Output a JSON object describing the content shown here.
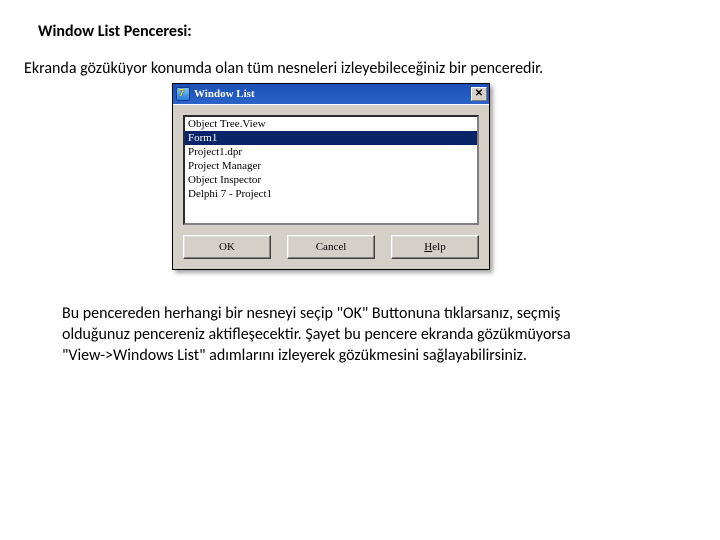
{
  "heading": "Window List Penceresi:",
  "intro": "Ekranda gözüküyor konumda olan tüm nesneleri izleyebileceğiniz bir penceredir.",
  "dialog": {
    "title": "Window List",
    "close_glyph": "✕",
    "list": {
      "items": [
        {
          "label": "Object Tree.View"
        },
        {
          "label": "Form1"
        },
        {
          "label": "Project1.dpr"
        },
        {
          "label": "Project Manager"
        },
        {
          "label": "Object Inspector"
        },
        {
          "label": "Delphi 7 - Project1"
        }
      ],
      "selected_index": 1
    },
    "buttons": {
      "ok": "OK",
      "cancel": "Cancel",
      "help_prefix": "H",
      "help_rest": "elp"
    }
  },
  "footer_lines": [
    "Bu pencereden herhangi bir nesneyi seçip \"OK\" Buttonuna tıklarsanız, seçmiş",
    "olduğunuz pencereniz aktifleşecektir. Şayet bu pencere ekranda gözükmüyorsa",
    "\"View->Windows List\" adımlarını izleyerek gözükmesini sağlayabilirsiniz."
  ]
}
